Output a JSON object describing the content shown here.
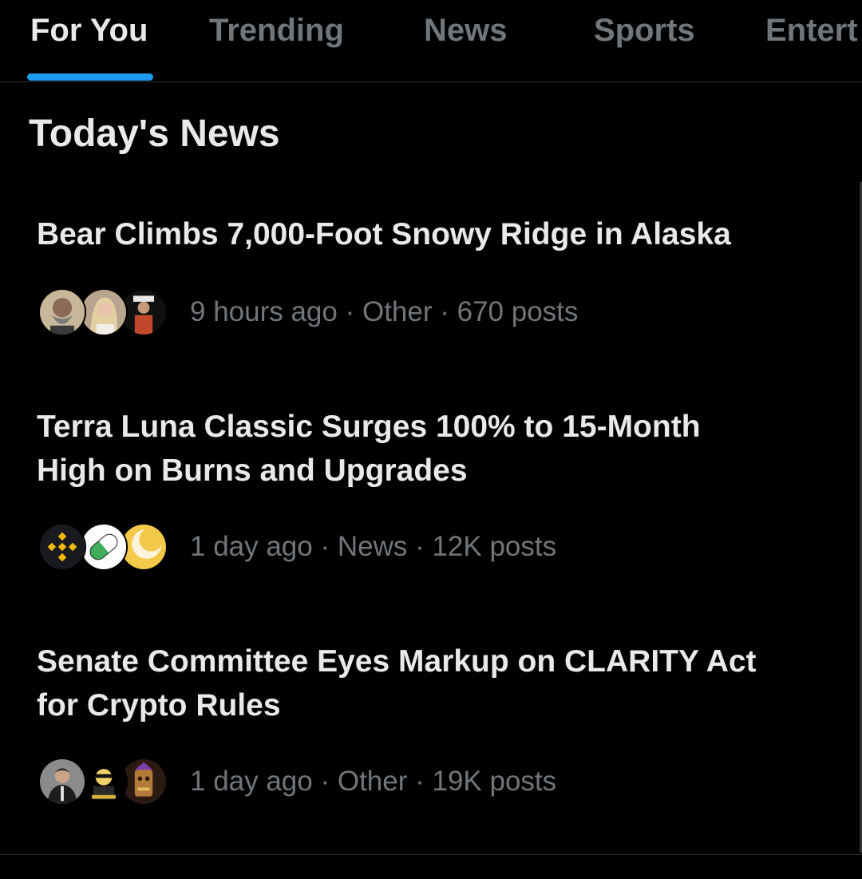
{
  "tabs": [
    {
      "label": "For You",
      "active": true
    },
    {
      "label": "Trending",
      "active": false
    },
    {
      "label": "News",
      "active": false
    },
    {
      "label": "Sports",
      "active": false
    },
    {
      "label": "Entert",
      "active": false
    }
  ],
  "colors": {
    "background": "#000000",
    "text_primary": "#e7e9ea",
    "text_secondary": "#71767b",
    "accent": "#1d9bf0",
    "divider": "#2f3336"
  },
  "section_title": "Today's News",
  "news": [
    {
      "headline_lines": [
        "Bear Climbs 7,000-Foot Snowy Ridge in Alaska"
      ],
      "meta": "9 hours ago · Other · 670 posts",
      "avatars": [
        "bearded-man-avatar",
        "blonde-woman-avatar",
        "person-with-hat-avatar"
      ]
    },
    {
      "headline_lines": [
        "Terra Luna Classic Surges 100% to 15-Month",
        "High on Burns and Upgrades"
      ],
      "meta": "1 day ago · News · 12K posts",
      "avatars": [
        "binance-logo-avatar",
        "green-pill-avatar",
        "yellow-crescent-avatar"
      ]
    },
    {
      "headline_lines": [
        "Senate Committee Eyes Markup on CLARITY Act",
        "for Crypto Rules"
      ],
      "meta": "1 day ago · Other · 19K posts",
      "avatars": [
        "man-in-suit-avatar",
        "cartoon-character-avatar",
        "tiki-mask-avatar"
      ]
    }
  ]
}
